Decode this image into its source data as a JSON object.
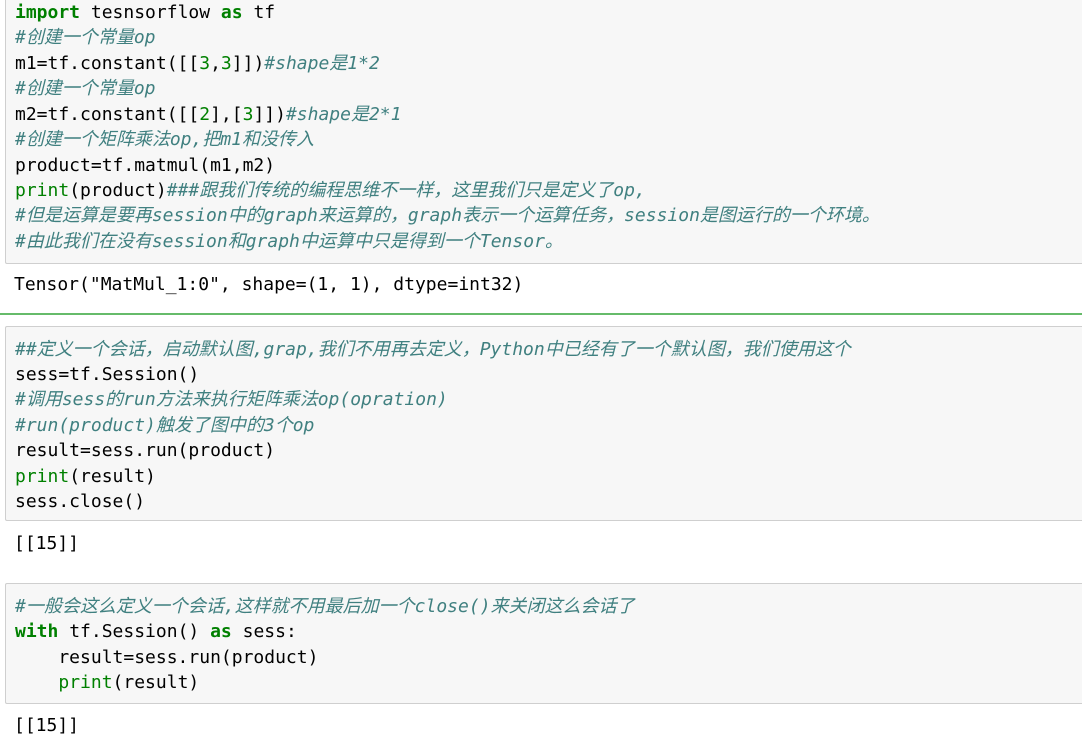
{
  "cells": [
    {
      "input_lines": [
        [
          {
            "t": "import",
            "c": "kw"
          },
          {
            "t": " tesnsorflow ",
            "c": ""
          },
          {
            "t": "as",
            "c": "kw"
          },
          {
            "t": " tf",
            "c": ""
          }
        ],
        [
          {
            "t": "#创建一个常量op",
            "c": "cm"
          }
        ],
        [
          {
            "t": "m1=tf.constant([[",
            "c": ""
          },
          {
            "t": "3",
            "c": "num"
          },
          {
            "t": ",",
            "c": ""
          },
          {
            "t": "3",
            "c": "num"
          },
          {
            "t": "]])",
            "c": ""
          },
          {
            "t": "#shape是1*2",
            "c": "cm"
          }
        ],
        [
          {
            "t": "#创建一个常量op",
            "c": "cm"
          }
        ],
        [
          {
            "t": "m2=tf.constant([[",
            "c": ""
          },
          {
            "t": "2",
            "c": "num"
          },
          {
            "t": "],[",
            "c": ""
          },
          {
            "t": "3",
            "c": "num"
          },
          {
            "t": "]])",
            "c": ""
          },
          {
            "t": "#shape是2*1",
            "c": "cm"
          }
        ],
        [
          {
            "t": "#创建一个矩阵乘法op,把m1和没传入",
            "c": "cm"
          }
        ],
        [
          {
            "t": "product=tf.matmul(m1,m2)",
            "c": ""
          }
        ],
        [
          {
            "t": "print",
            "c": "bi"
          },
          {
            "t": "(product)",
            "c": ""
          },
          {
            "t": "###跟我们传统的编程思维不一样，这里我们只是定义了op,",
            "c": "cm"
          }
        ],
        [
          {
            "t": "#但是运算是要再session中的graph来运算的，graph表示一个运算任务，session是图运行的一个环境。",
            "c": "cm"
          }
        ],
        [
          {
            "t": "#由此我们在没有session和graph中运算中只是得到一个Tensor。",
            "c": "cm"
          }
        ]
      ],
      "output": "Tensor(\"MatMul_1:0\", shape=(1, 1), dtype=int32)"
    },
    {
      "input_lines": [
        [
          {
            "t": "##定义一个会话，启动默认图,grap,我们不用再去定义，Python中已经有了一个默认图，我们使用这个",
            "c": "cm"
          }
        ],
        [
          {
            "t": "sess=tf.Session()",
            "c": ""
          }
        ],
        [
          {
            "t": "#调用sess的run方法来执行矩阵乘法op(opration)",
            "c": "cm"
          }
        ],
        [
          {
            "t": "#run(product)触发了图中的3个op",
            "c": "cm"
          }
        ],
        [
          {
            "t": "result=sess.run(product)",
            "c": ""
          }
        ],
        [
          {
            "t": "print",
            "c": "bi"
          },
          {
            "t": "(result)",
            "c": ""
          }
        ],
        [
          {
            "t": "sess.close()",
            "c": ""
          }
        ]
      ],
      "output": "[[15]]"
    },
    {
      "input_lines": [
        [
          {
            "t": "#一般会这么定义一个会话,这样就不用最后加一个close()来关闭这么会话了",
            "c": "cm"
          }
        ],
        [
          {
            "t": "with",
            "c": "kw"
          },
          {
            "t": " tf.Session() ",
            "c": ""
          },
          {
            "t": "as",
            "c": "kw"
          },
          {
            "t": " sess:",
            "c": ""
          }
        ],
        [
          {
            "t": "    result=sess.run(product)",
            "c": ""
          }
        ],
        [
          {
            "t": "    ",
            "c": ""
          },
          {
            "t": "print",
            "c": "bi"
          },
          {
            "t": "(result)",
            "c": ""
          }
        ]
      ],
      "output": "[[15]]"
    }
  ]
}
